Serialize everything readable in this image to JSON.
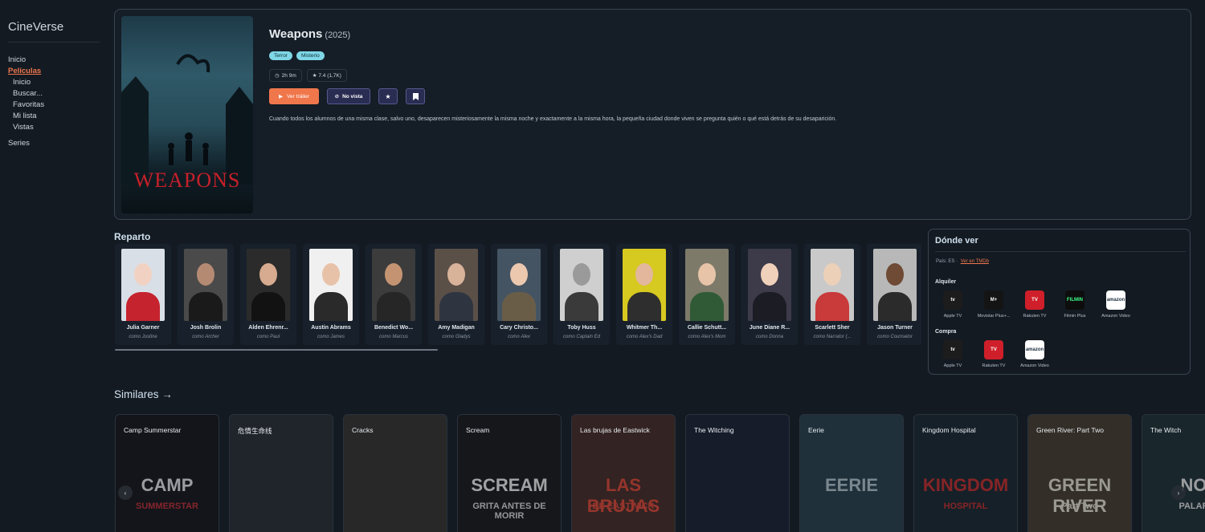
{
  "app": {
    "brand": "CineVerse"
  },
  "nav": {
    "home": "Inicio",
    "movies": "Películas",
    "sub": [
      "Inicio",
      "Buscar...",
      "Favoritas",
      "Mi lista",
      "Vistas"
    ],
    "series": "Series"
  },
  "movie": {
    "title": "Weapons",
    "year": "(2025)",
    "poster_text": "WEAPONS",
    "genres": [
      "Terror",
      "Misterio"
    ],
    "runtime": "2h 9m",
    "rating": "★ 7.4 (1,7K)",
    "trailer_label": "Ver tráiler",
    "watched_label": "No vista",
    "synopsis": "Cuando todos los alumnos de una misma clase, salvo uno, desaparecen misteriosamente la misma noche y exactamente a la misma hora, la pequeña ciudad donde viven se pregunta quién o qué está detrás de su desaparición."
  },
  "cast": {
    "title": "Reparto",
    "members": [
      {
        "name": "Julia Garner",
        "role": "como Justine",
        "bg": "#d9dfe6",
        "skin": "#f1d2c2",
        "cloth": "#c5232e"
      },
      {
        "name": "Josh Brolin",
        "role": "como Archer",
        "bg": "#4a4a4a",
        "skin": "#b58a73",
        "cloth": "#1a1a1a"
      },
      {
        "name": "Alden Ehrenr...",
        "role": "como Paul",
        "bg": "#2b2b2b",
        "skin": "#d6ab90",
        "cloth": "#121212"
      },
      {
        "name": "Austin Abrams",
        "role": "como James",
        "bg": "#f0f0f0",
        "skin": "#e8c2a8",
        "cloth": "#2a2a2a"
      },
      {
        "name": "Benedict Wo...",
        "role": "como Marcus",
        "bg": "#3c3c3c",
        "skin": "#c49472",
        "cloth": "#262626"
      },
      {
        "name": "Amy Madigan",
        "role": "como Gladys",
        "bg": "#5b5048",
        "skin": "#d9b29a",
        "cloth": "#2f3540"
      },
      {
        "name": "Cary Christo...",
        "role": "como Alex",
        "bg": "#445463",
        "skin": "#ecc8ae",
        "cloth": "#6a5d48"
      },
      {
        "name": "Toby Huss",
        "role": "como Captain Ed",
        "bg": "#cfcfcf",
        "skin": "#9a9a9a",
        "cloth": "#3a3a3a"
      },
      {
        "name": "Whitmer Th...",
        "role": "como Alex's Dad",
        "bg": "#d6c920",
        "skin": "#e2b79c",
        "cloth": "#2e2e2e"
      },
      {
        "name": "Callie Schutt...",
        "role": "como Alex's Mom",
        "bg": "#7d7a6a",
        "skin": "#e7c4a8",
        "cloth": "#2f5a35"
      },
      {
        "name": "June Diane R...",
        "role": "como Donna",
        "bg": "#3d3a4a",
        "skin": "#efd0ba",
        "cloth": "#1c1c24"
      },
      {
        "name": "Scarlett Sher",
        "role": "como Narrator (...",
        "bg": "#c9c9c9",
        "skin": "#ecd0b8",
        "cloth": "#c93a3a"
      },
      {
        "name": "Jason Turner",
        "role": "como Counselor",
        "bg": "#b8b8b8",
        "skin": "#6f4a34",
        "cloth": "#2b2b2b"
      }
    ]
  },
  "watch": {
    "title": "Dónde ver",
    "country": "País: ES ·",
    "tmdb_link": "Ver en TMDb",
    "rent_label": "Alquiler",
    "buy_label": "Compra",
    "rent": [
      {
        "name": "Apple TV",
        "logo": "tv",
        "bg": "#1c1c1c",
        "fg": "#ffffff"
      },
      {
        "name": "Movistar Plus+...",
        "logo": "M+",
        "bg": "#141414",
        "fg": "#ffffff"
      },
      {
        "name": "Rakuten TV",
        "logo": "TV",
        "bg": "#cf1f2a",
        "fg": "#ffffff"
      },
      {
        "name": "Filmin Plus",
        "logo": "FILMIN",
        "bg": "#0d0d0d",
        "fg": "#3cff8a"
      },
      {
        "name": "Amazon Video",
        "logo": "amazon",
        "bg": "#ffffff",
        "fg": "#1a2b3c"
      }
    ],
    "buy": [
      {
        "name": "Apple TV",
        "logo": "tv",
        "bg": "#1c1c1c",
        "fg": "#ffffff"
      },
      {
        "name": "Rakuten TV",
        "logo": "TV",
        "bg": "#cf1f2a",
        "fg": "#ffffff"
      },
      {
        "name": "Amazon Video",
        "logo": "amazon",
        "bg": "#ffffff",
        "fg": "#1a2b3c"
      }
    ]
  },
  "similar": {
    "title": "Similares →",
    "items": [
      {
        "title": "Camp Summerstar",
        "art": "CAMP",
        "art2": "SUMMERSTAR",
        "bg": "#1a1a1e",
        "art_color": "#e8e8ea",
        "art2_color": "#c8303a"
      },
      {
        "title": "危情生命线",
        "art": "",
        "art2": "",
        "bg": "#2d3038",
        "art_color": "#ffffff",
        "art2_color": "#ffffff"
      },
      {
        "title": "Cracks",
        "art": "",
        "art2": "",
        "bg": "#3a3634",
        "art_color": "#ffffff",
        "art2_color": "#ffffff"
      },
      {
        "title": "Scream",
        "art": "SCREAM",
        "art2": "GRITA ANTES DE MORIR",
        "bg": "#1d1d1f",
        "art_color": "#f2f2f2",
        "art2_color": "#dddddd"
      },
      {
        "title": "Las brujas de Eastwick",
        "art": "LAS BRUJAS",
        "art2": "DE EASTWICK",
        "bg": "#4a2e2a",
        "art_color": "#e04a3a",
        "art2_color": "#e04a3a"
      },
      {
        "title": "The Witching",
        "art": "",
        "art2": "",
        "bg": "#1f2436",
        "art_color": "#ffffff",
        "art2_color": "#ffffff"
      },
      {
        "title": "Eerie",
        "art": "EERIE",
        "art2": "",
        "bg": "#2b4350",
        "art_color": "#b7c7d0",
        "art2_color": "#ffffff"
      },
      {
        "title": "Kingdom Hospital",
        "art": "KINGDOM",
        "art2": "HOSPITAL",
        "bg": "#1e2a34",
        "art_color": "#c93030",
        "art2_color": "#c93030"
      },
      {
        "title": "Green River: Part Two",
        "art": "GREEN RIVER",
        "art2": "Part Two",
        "bg": "#4a4034",
        "art_color": "#e8e2d6",
        "art2_color": "#e8e2d6"
      },
      {
        "title": "The Witch",
        "art": "NO",
        "art2": "PALAR",
        "bg": "#23333a",
        "art_color": "#e8e8e8",
        "art2_color": "#e8e8e8"
      }
    ]
  }
}
